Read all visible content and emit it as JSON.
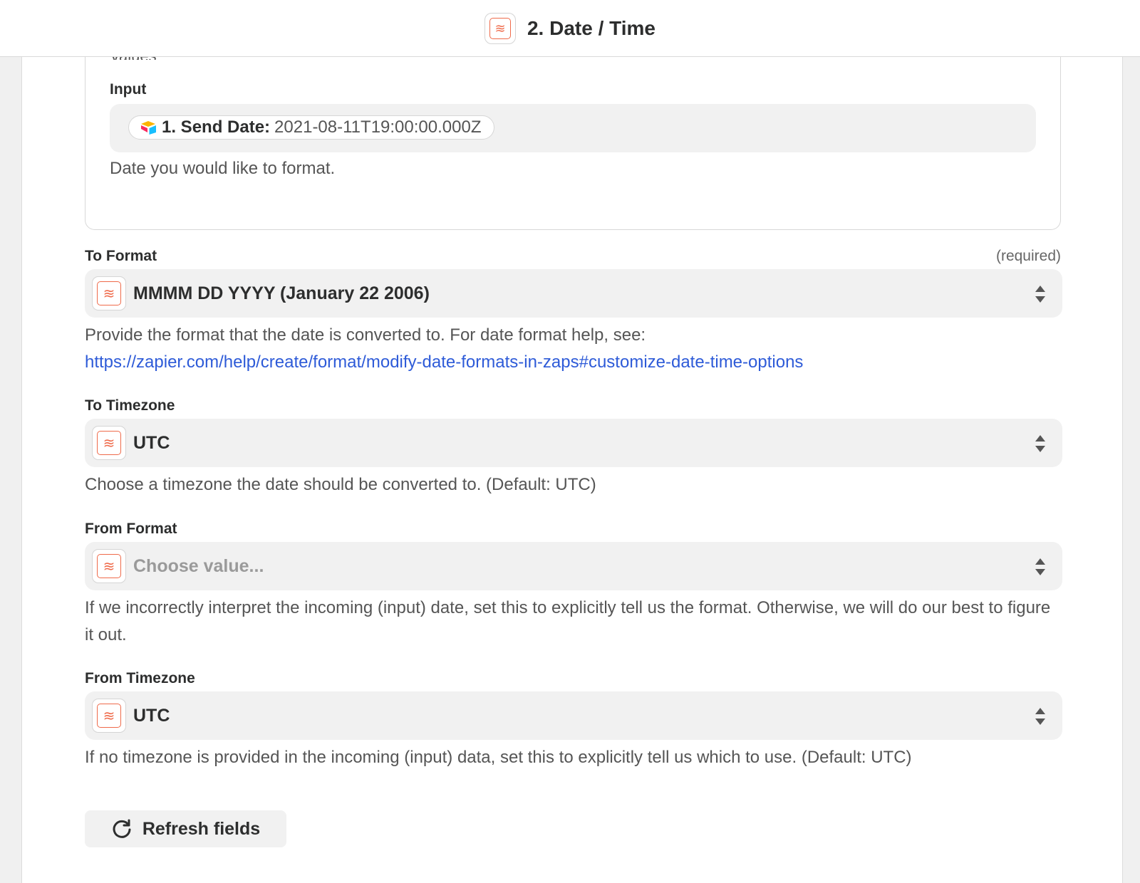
{
  "header": {
    "title": "2. Date / Time",
    "app_icon": "formatter-icon"
  },
  "values_section": {
    "legend": "Values",
    "input_label": "Input",
    "input_token": {
      "key": "1. Send Date:",
      "value": "2021-08-11T19:00:00.000Z",
      "icon": "airtable-icon"
    },
    "input_help": "Date you would like to format."
  },
  "fields": [
    {
      "label": "To Format",
      "required_text": "(required)",
      "value": "MMMM DD YYYY (January 22 2006)",
      "help": "Provide the format that the date is converted to. For date format help, see:",
      "help_link": "https://zapier.com/help/create/format/modify-date-formats-in-zaps#customize-date-time-options"
    },
    {
      "label": "To Timezone",
      "value": "UTC",
      "help": "Choose a timezone the date should be converted to. (Default: UTC)"
    },
    {
      "label": "From Format",
      "placeholder": "Choose value...",
      "help": "If we incorrectly interpret the incoming (input) date, set this to explicitly tell us the format. Otherwise, we will do our best to figure it out."
    },
    {
      "label": "From Timezone",
      "value": "UTC",
      "help": "If no timezone is provided in the incoming (input) data, set this to explicitly tell us which to use. (Default: UTC)"
    }
  ],
  "actions": {
    "refresh_label": "Refresh fields",
    "refresh_icon": "refresh-icon"
  },
  "colors": {
    "accent": "#ef6a4a",
    "link": "#2e5bd8",
    "field_bg": "#f1f1f1"
  }
}
